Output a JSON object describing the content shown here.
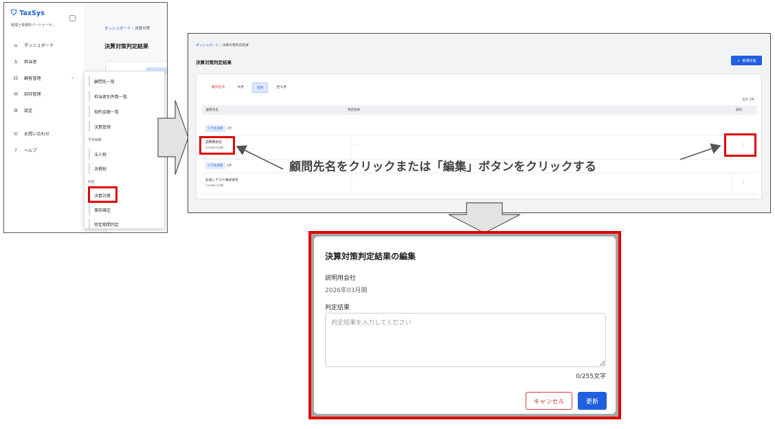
{
  "panel1": {
    "app_name": "TaxSys",
    "org_name": "税理士事務所パートナーサ…",
    "nav": [
      {
        "label": "ダッシュボード",
        "icon": "home-icon"
      },
      {
        "label": "担当者",
        "icon": "person-icon"
      },
      {
        "label": "顧客管理",
        "icon": "headset-icon"
      },
      {
        "label": "招待管理",
        "icon": "mail-icon"
      },
      {
        "label": "設定",
        "icon": "gear-icon"
      },
      {
        "label": "お問い合わせ",
        "icon": "chat-icon"
      },
      {
        "label": "ヘルプ",
        "icon": "help-icon"
      }
    ],
    "breadcrumb_link": "ダッシュボード",
    "breadcrumb_sep": "›",
    "breadcrumb_current": "決算対策",
    "page_title": "決算対策判定結果",
    "submenu": {
      "items_a": [
        "顧問先一覧",
        "担当者別件数一覧",
        "契約金額一覧",
        "決算管理"
      ],
      "group_b": "予定納税",
      "items_b": [
        "法人税",
        "消費税"
      ],
      "group_c": "判定",
      "items_c": [
        "決算対策",
        "事前確定",
        "特定期間判定"
      ]
    }
  },
  "panel2": {
    "breadcrumb_link": "ダッシュボード",
    "breadcrumb_sep": "›",
    "breadcrumb_current": "決算対策判定結果",
    "title": "決算対策判定結果",
    "new_button": "新規作成",
    "tabs": [
      "要対応済",
      "今月",
      "翌月",
      "翌々月"
    ],
    "active_tab": "翌月",
    "total": "合計 2件",
    "columns": [
      "顧客先名",
      "判定結果",
      "操作"
    ],
    "rows": [
      {
        "type": "group",
        "tag": "ソラ木太郎",
        "count": "1件"
      },
      {
        "type": "item",
        "name": "説明用会社",
        "period": "2026年03月期",
        "result": "-"
      },
      {
        "type": "group",
        "tag": "ソラ木太郎",
        "count": "1件"
      },
      {
        "type": "item",
        "name": "お試しテスト株式会社",
        "period": "2026年03月期",
        "result": "-"
      }
    ]
  },
  "annotation": "顧問先名をクリックまたは「編集」ボタンをクリックする",
  "dialog": {
    "title": "決算対策判定結果の編集",
    "company": "説明用会社",
    "period": "2026年03月期",
    "field_label": "判定結果",
    "placeholder": "判定結果を入力してください",
    "value": "",
    "counter": "0/255文字",
    "cancel": "キャンセル",
    "update": "更新"
  },
  "colors": {
    "highlight": "#e00000",
    "primary": "#1f5fe0",
    "danger": "#d23b3b"
  }
}
